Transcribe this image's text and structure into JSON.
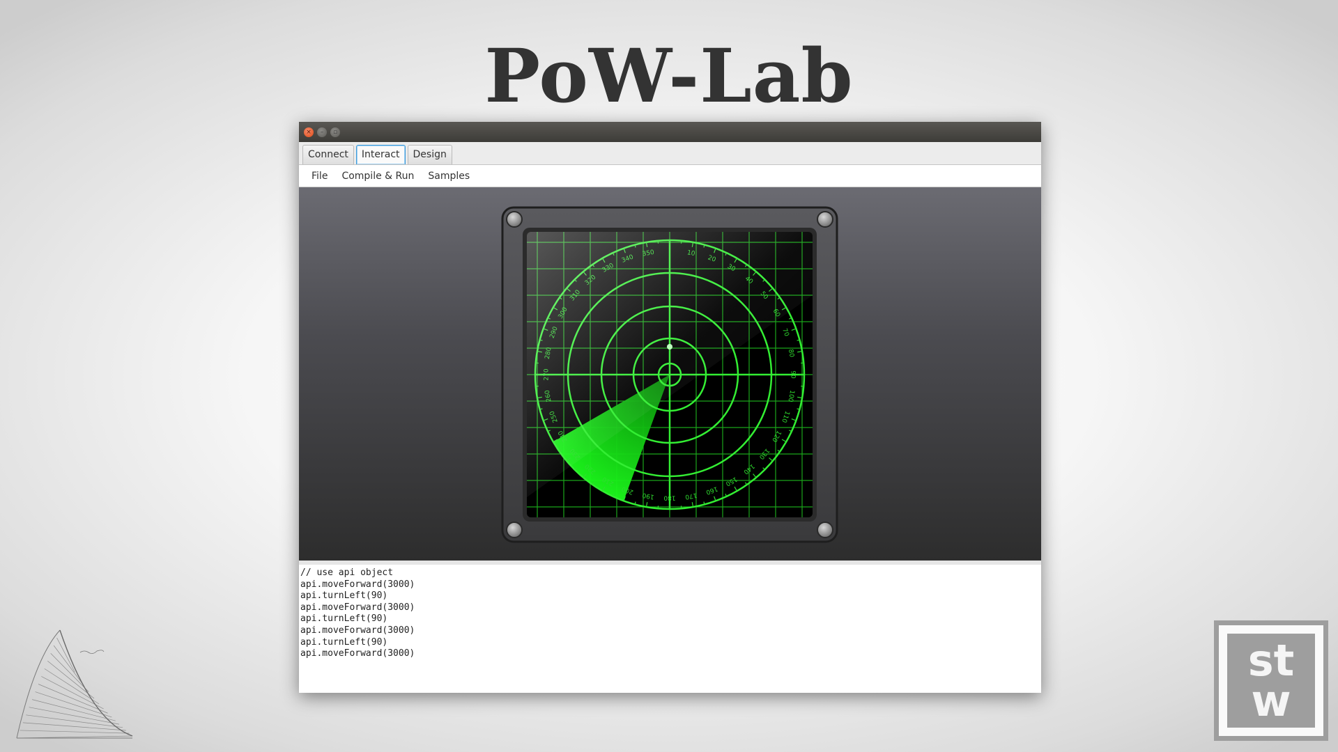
{
  "slide": {
    "title": "PoW-Lab"
  },
  "window": {
    "controls": [
      {
        "name": "close",
        "icon": "close-icon",
        "glyph": "×"
      },
      {
        "name": "minimize",
        "icon": "minimize-icon",
        "glyph": "–"
      },
      {
        "name": "maximize",
        "icon": "maximize-icon",
        "glyph": "▫"
      }
    ]
  },
  "tabs": [
    {
      "label": "Connect",
      "active": false
    },
    {
      "label": "Interact",
      "active": true
    },
    {
      "label": "Design",
      "active": false
    }
  ],
  "menu": [
    "File",
    "Compile & Run",
    "Samples"
  ],
  "radar": {
    "dial_labels": [
      "10",
      "20",
      "30",
      "40",
      "50",
      "60",
      "70",
      "80",
      "90",
      "100",
      "110",
      "120",
      "130",
      "140",
      "150",
      "160",
      "170",
      "180",
      "190",
      "200",
      "210",
      "220",
      "230",
      "240",
      "250",
      "260",
      "270",
      "280",
      "290",
      "300",
      "310",
      "320",
      "330",
      "340",
      "350"
    ],
    "sweep_start_deg": 200,
    "sweep_end_deg": 240,
    "blip_visible": true,
    "colors": {
      "screen": "#000000",
      "grid": "#1fc21f",
      "rings": "#33ee33",
      "sweep": "#16e016"
    }
  },
  "code_editor": {
    "lines": [
      "// use api object",
      "api.moveForward(3000)",
      "api.turnLeft(90)",
      "api.moveForward(3000)",
      "api.turnLeft(90)",
      "api.moveForward(3000)",
      "api.turnLeft(90)",
      "api.moveForward(3000)"
    ]
  },
  "logos": {
    "bottom_right": {
      "top": "st",
      "bottom": "w"
    }
  }
}
